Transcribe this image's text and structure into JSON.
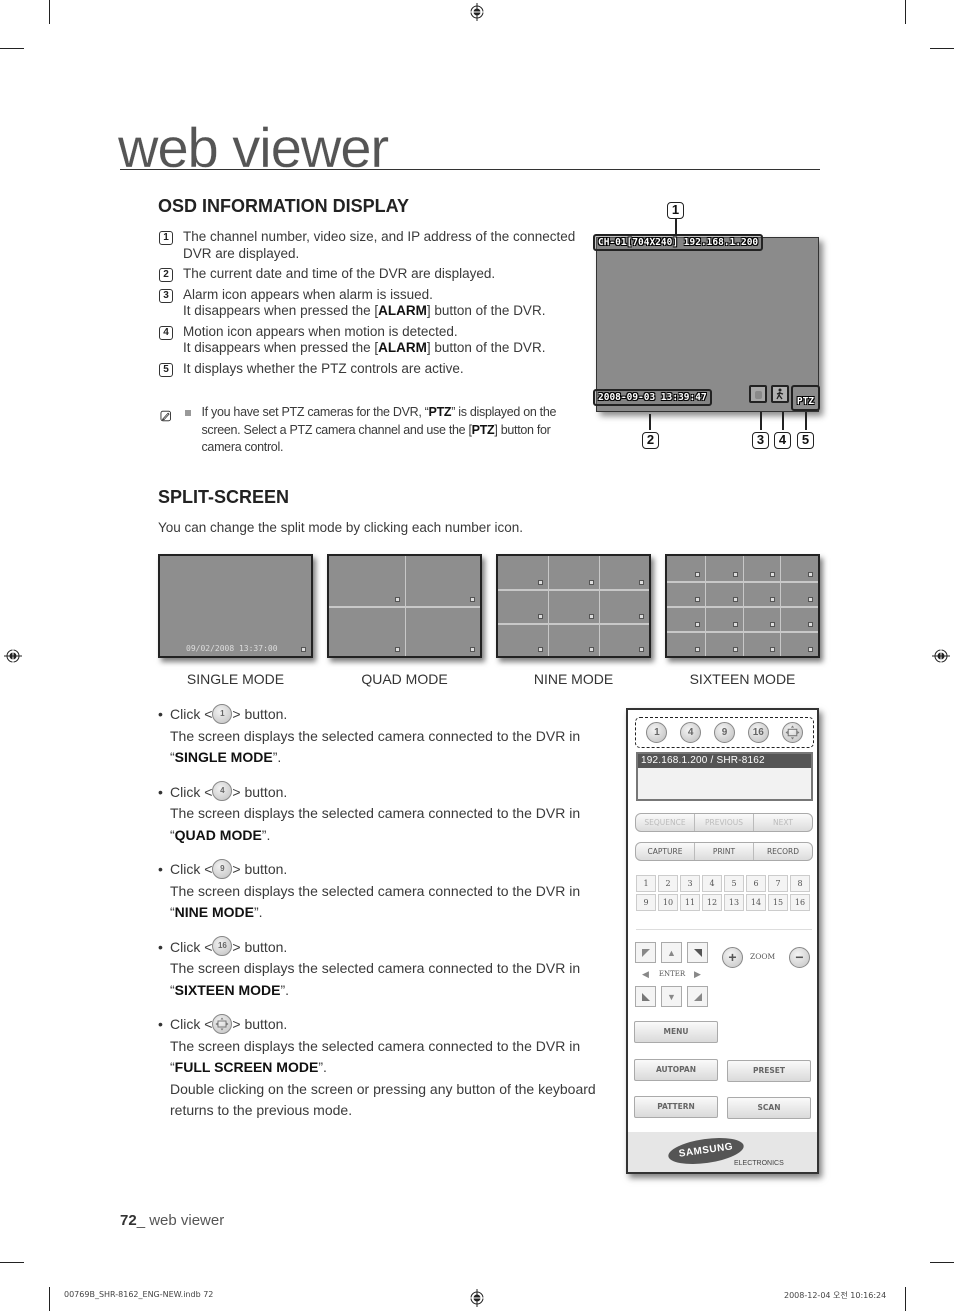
{
  "page": {
    "chapter_title": "web viewer",
    "footer_page_number": "72",
    "footer_section": "_ web viewer",
    "print_file": "00769B_SHR-8162_ENG-NEW.indb   72",
    "print_timestamp": "2008-12-04   오전 10:16:24"
  },
  "osd": {
    "heading": "OSD INFORMATION DISPLAY",
    "items": [
      {
        "num": "1",
        "text": "The channel number, video size, and IP address of the connected DVR are displayed."
      },
      {
        "num": "2",
        "text": "The current date and time of the DVR are displayed."
      },
      {
        "num": "3",
        "line1": "Alarm icon appears when alarm is issued.",
        "line2_pre": "It disappears when pressed the [",
        "line2_bold": "ALARM",
        "line2_post": "] button of the DVR."
      },
      {
        "num": "4",
        "line1": "Motion icon appears when motion is detected.",
        "line2_pre": "It disappears when pressed the [",
        "line2_bold": "ALARM",
        "line2_post": "] button of the DVR."
      },
      {
        "num": "5",
        "text": "It displays whether the PTZ controls are active."
      }
    ],
    "note": {
      "icon": "note-pencil-icon",
      "pre": "If you have set PTZ cameras for the DVR, “",
      "bold1": "PTZ",
      "mid": "” is displayed on the screen. Select a PTZ camera channel and use the [",
      "bold2": "PTZ",
      "post": "] button for camera control."
    },
    "screen": {
      "channel_info": "CH-01[704X240] 192.168.1.200",
      "datetime": "2008-09-03 13:39:47",
      "alarm_icon": "alarm-icon",
      "motion_icon": "motion-icon",
      "ptz_label": "PTZ",
      "callouts": [
        "1",
        "2",
        "3",
        "4",
        "5"
      ]
    }
  },
  "split": {
    "heading": "SPLIT-SCREEN",
    "intro": "You can change the split mode by clicking each number icon.",
    "modes": [
      {
        "label": "SINGLE MODE",
        "grid": 1,
        "overlay_time": "09/02/2008  13:37:00"
      },
      {
        "label": "QUAD MODE",
        "grid": 2
      },
      {
        "label": "NINE MODE",
        "grid": 3
      },
      {
        "label": "SIXTEEN MODE",
        "grid": 4
      }
    ],
    "instructions": [
      {
        "button": "1",
        "click_pre": "Click <",
        "click_post": "> button.",
        "desc": "The screen displays the selected camera connected to the DVR in",
        "mode": "SINGLE MODE"
      },
      {
        "button": "4",
        "click_pre": "Click <",
        "click_post": "> button.",
        "desc": "The screen displays the selected camera connected to the DVR in",
        "mode": "QUAD MODE"
      },
      {
        "button": "9",
        "click_pre": "Click <",
        "click_post": "> button.",
        "desc": "The screen displays the selected camera connected to the DVR in",
        "mode": "NINE MODE"
      },
      {
        "button": "16",
        "click_pre": "Click <",
        "click_post": "> button.",
        "desc": "The screen displays the selected camera connected to the DVR in",
        "mode": "SIXTEEN MODE"
      },
      {
        "button": "fullscreen-icon",
        "click_pre": "Click <",
        "click_post": "> button.",
        "desc": "The screen displays the selected camera connected to the DVR in",
        "mode": "FULL SCREEN MODE",
        "extra": "Double clicking on the screen or pressing any button of the keyboard returns to the previous mode."
      }
    ]
  },
  "panel": {
    "mode_buttons": [
      "1",
      "4",
      "9",
      "16"
    ],
    "fullscreen_icon": "fullscreen-icon",
    "dvr_list_item": "192.168.1.200   / SHR-8162",
    "nav_buttons": [
      "SEQUENCE",
      "PREVIOUS",
      "NEXT"
    ],
    "action_buttons": [
      "CAPTURE",
      "PRINT",
      "RECORD"
    ],
    "channels": [
      "1",
      "2",
      "3",
      "4",
      "5",
      "6",
      "7",
      "8",
      "9",
      "10",
      "11",
      "12",
      "13",
      "14",
      "15",
      "16"
    ],
    "ptz_enter": "ENTER",
    "zoom_label": "ZOOM",
    "zoom_in": "+",
    "zoom_out": "−",
    "menu": "MENU",
    "autopan": "AUTOPAN",
    "preset": "PRESET",
    "pattern": "PATTERN",
    "scan": "SCAN",
    "brand": "SAMSUNG",
    "brand_sub": "ELECTRONICS"
  }
}
